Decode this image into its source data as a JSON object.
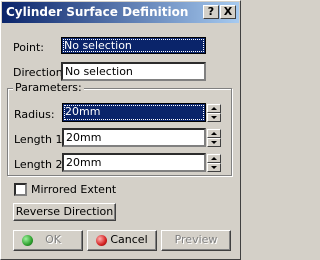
{
  "window": {
    "title": "Cylinder Surface Definition",
    "help_label": "?",
    "close_label": "X"
  },
  "point": {
    "label": "Point:",
    "value": "No selection"
  },
  "direction": {
    "label": "Direction:",
    "value": "No selection"
  },
  "parameters": {
    "group_title": "Parameters:",
    "radius": {
      "label": "Radius:",
      "value": "20mm"
    },
    "length1": {
      "label": "Length 1:",
      "value": "20mm"
    },
    "length2": {
      "label": "Length 2:",
      "value": "20mm"
    }
  },
  "mirrored_extent": {
    "label": "Mirrored Extent",
    "checked": false
  },
  "reverse_direction_label": "Reverse Direction",
  "buttons": {
    "ok": "OK",
    "cancel": "Cancel",
    "preview": "Preview"
  },
  "colors": {
    "title_bar_start": "#0a246a",
    "title_bar_end": "#a6caf0",
    "ok_icon": "#2ea02e",
    "cancel_icon": "#d42020"
  }
}
